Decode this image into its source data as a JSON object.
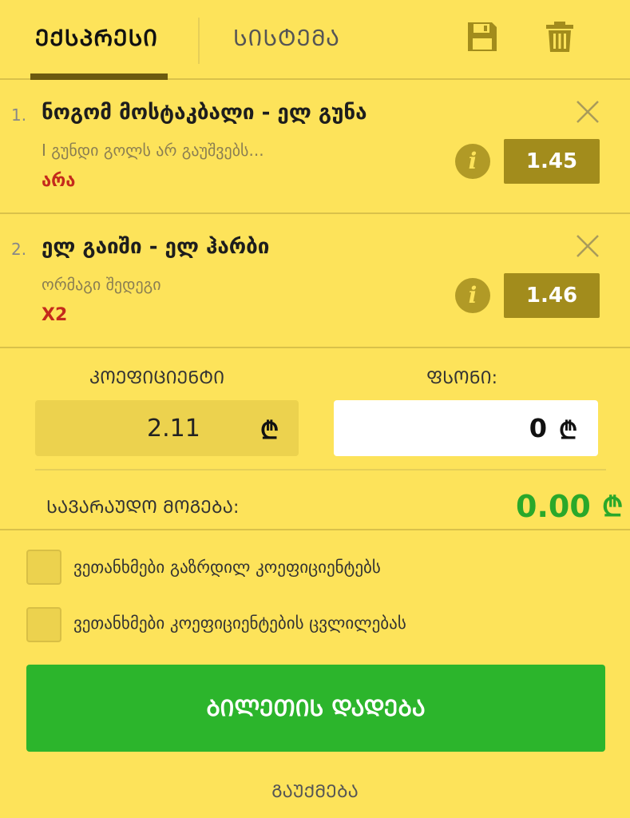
{
  "header": {
    "tabs": [
      {
        "label": "ᲔᲥᲡᲞᲠᲔᲡᲘ",
        "active": true
      },
      {
        "label": "ᲡᲘᲡᲢᲔᲛᲐ",
        "active": false
      }
    ],
    "icons": [
      "save-icon",
      "trash-icon"
    ]
  },
  "bets": [
    {
      "num": "1.",
      "title": "ნოგომ მოსტაკბალი - ელ გუნა",
      "market": "I გუნდი გოლს არ გაუშვებს...",
      "pick": "არა",
      "odd": "1.45"
    },
    {
      "num": "2.",
      "title": "ელ გაიში - ელ ჰარბი",
      "market": "ორმაგი შედეგი",
      "pick": "X2",
      "odd": "1.46"
    }
  ],
  "summary": {
    "coef_label": "ᲙᲝᲔᲤᲘᲪᲘᲔᲜᲢᲘ",
    "coef_value": "2.11",
    "stake_label": "ᲤᲡᲝᲜᲘ:",
    "stake_value": "0",
    "currency": "₾",
    "win_label": "ᲡᲐᲕᲐᲠᲐᲣᲓᲝ ᲛᲝᲒᲔᲑᲐ:",
    "win_value": "0.00"
  },
  "options": [
    {
      "label": "ვეთანხმები გაზრდილ კოეფიციენტებს",
      "checked": false
    },
    {
      "label": "ვეთანხმები კოეფიციენტების ცვლილებას",
      "checked": false
    }
  ],
  "actions": {
    "place_label": "ᲑᲘᲚᲔᲗᲘᲡ ᲓᲐᲓᲔᲑᲐ",
    "cancel_label": "ᲒᲐᲣᲥᲛᲔᲑᲐ"
  },
  "colors": {
    "background": "#fde35a",
    "odd_box": "#a28c1c",
    "pick_red": "#c42a1c",
    "win_green": "#2aa82a",
    "button_green": "#2cb52c"
  }
}
